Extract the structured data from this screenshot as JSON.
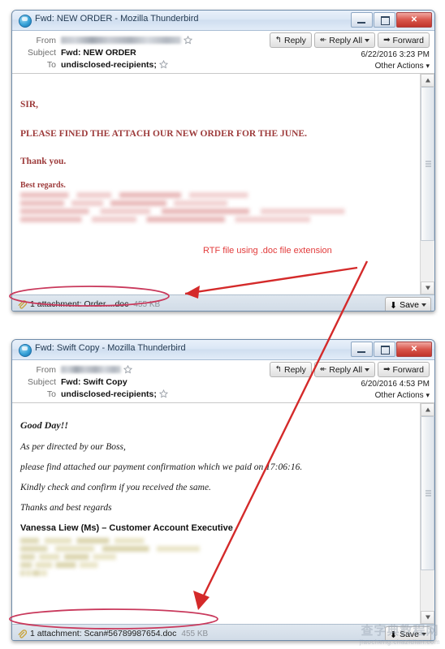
{
  "windows": [
    {
      "title": "Fwd: NEW ORDER - Mozilla Thunderbird",
      "app_icon": "thunderbird-icon",
      "header": {
        "from_label": "From",
        "from_value": "",
        "subject_label": "Subject",
        "subject_value": "Fwd: NEW ORDER",
        "to_label": "To",
        "to_value": "undisclosed-recipients;",
        "date": "6/22/2016 3:23 PM",
        "other_actions": "Other Actions",
        "reply": "Reply",
        "reply_all": "Reply All",
        "forward": "Forward"
      },
      "body": {
        "lines": [
          "SIR,",
          "PLEASE FINED THE ATTACH OUR NEW ORDER FOR  THE JUNE.",
          "Thank you.",
          "Best regards."
        ]
      },
      "attachment": {
        "count_text": "1 attachment: Order....doc",
        "size": "455 KB",
        "save_label": "Save"
      },
      "window_buttons": {
        "minimize": "minimize",
        "maximize": "maximize",
        "close": "close"
      }
    },
    {
      "title": "Fwd: Swift Copy - Mozilla Thunderbird",
      "app_icon": "thunderbird-icon",
      "header": {
        "from_label": "From",
        "from_value": "",
        "subject_label": "Subject",
        "subject_value": "Fwd: Swift Copy",
        "to_label": "To",
        "to_value": "undisclosed-recipients;",
        "date": "6/20/2016 4:53 PM",
        "other_actions": "Other Actions",
        "reply": "Reply",
        "reply_all": "Reply All",
        "forward": "Forward"
      },
      "body": {
        "lines": [
          "Good Day!!",
          "As per directed by our Boss,",
          "please find attached our payment confirmation which we paid on 17:06:16.",
          "Kindly check and confirm if you received the same.",
          "Thanks and best regards"
        ],
        "signature": "Vanessa Liew (Ms) – Customer Account Executive"
      },
      "attachment": {
        "count_text": "1 attachment: Scan#56789987654.doc",
        "size": "455 KB",
        "save_label": "Save"
      },
      "window_buttons": {
        "minimize": "minimize",
        "maximize": "maximize",
        "close": "close"
      }
    }
  ],
  "annotations": {
    "callout": "RTF file using .doc file extension",
    "accent_color": "#e23b3b",
    "highlight_color": "#c9395c"
  },
  "watermark": {
    "cn": "查字典教程网",
    "en": "jiaocheng.chazidian.com"
  }
}
